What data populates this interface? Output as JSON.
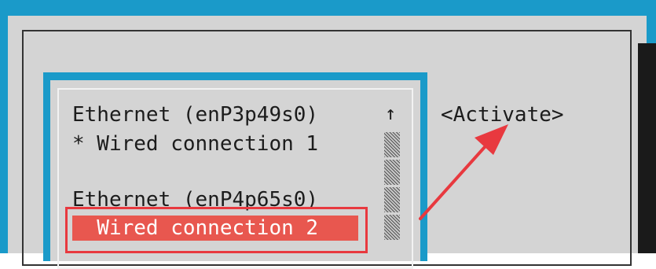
{
  "list": {
    "items": [
      {
        "text": "Ethernet (enP3p49s0)"
      },
      {
        "text": "* Wired connection 1"
      },
      {
        "text": "Ethernet (enP4p65s0)"
      },
      {
        "text": "  Wired connection 2"
      }
    ],
    "scroll_up_glyph": "↑"
  },
  "actions": {
    "activate_label": "<Activate>"
  },
  "colors": {
    "terminal_bg": "#1a9ac9",
    "dialog_bg": "#d4d4d4",
    "selection": "#e8574f",
    "annotation": "#e8393f"
  }
}
